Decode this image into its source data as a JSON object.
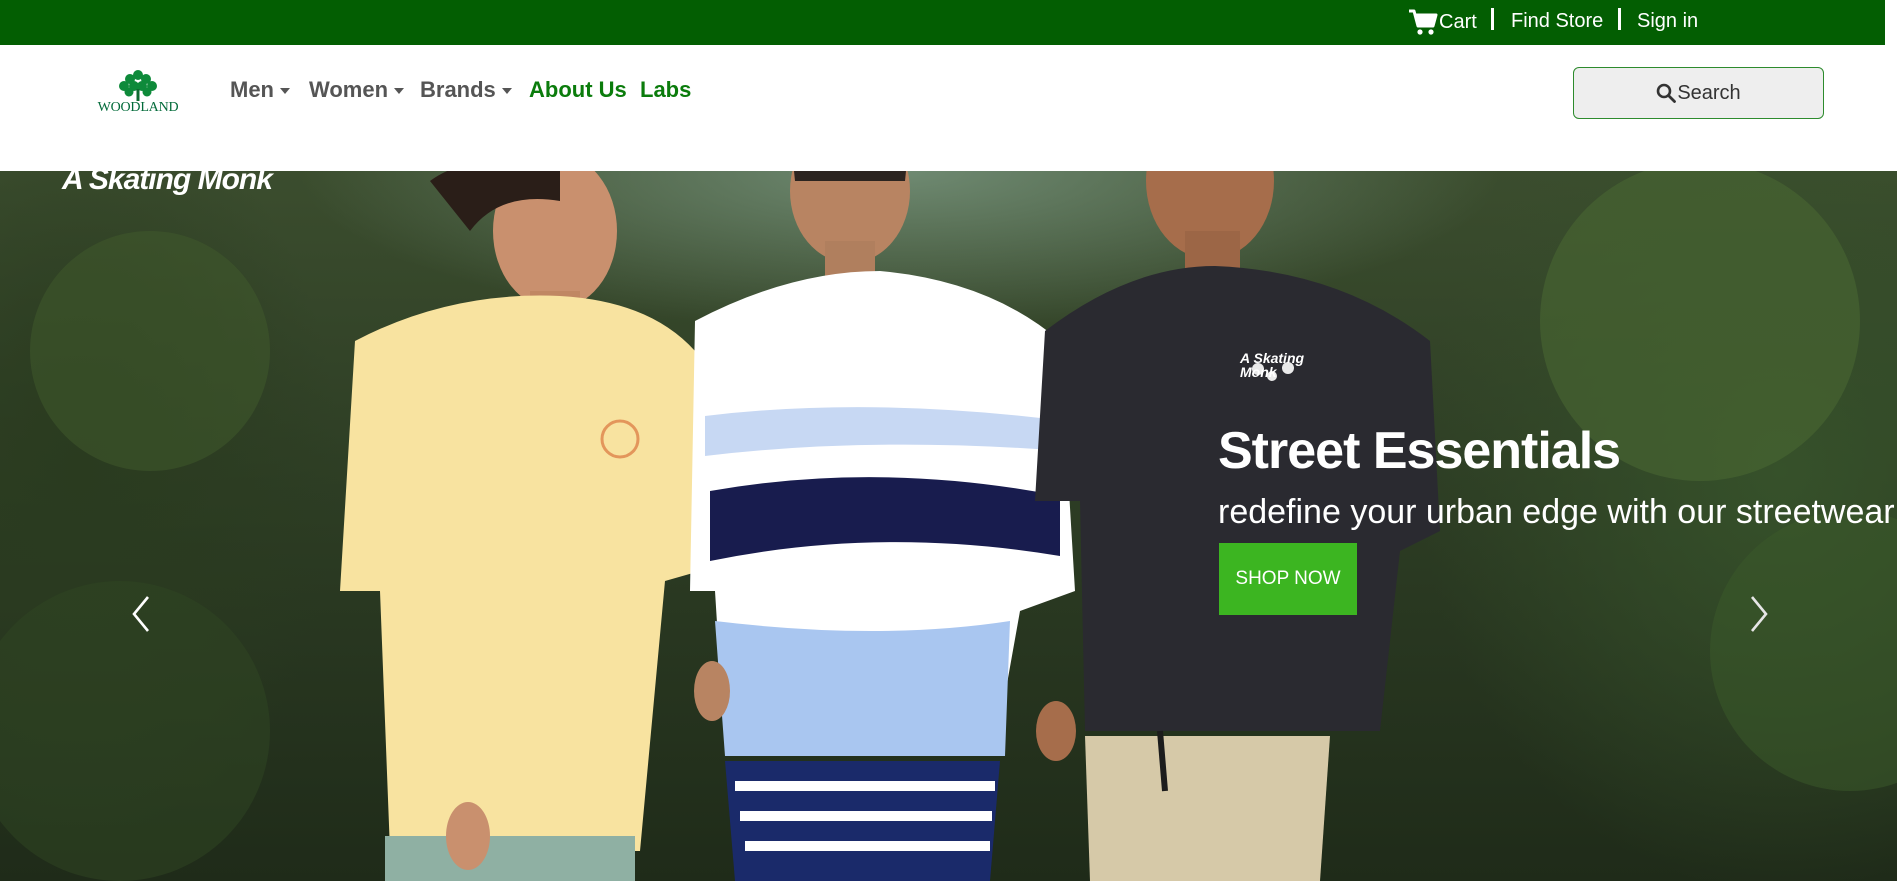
{
  "topbar": {
    "cart_label": "Cart",
    "find_store_label": "Find Store",
    "sign_in_label": "Sign in",
    "background": "#035e02"
  },
  "navbar": {
    "logo_text": "WOODLAND",
    "items": [
      {
        "label": "Men",
        "dropdown": true
      },
      {
        "label": "Women",
        "dropdown": true
      },
      {
        "label": "Brands",
        "dropdown": true
      },
      {
        "label": "About Us",
        "dropdown": false
      },
      {
        "label": "Labs",
        "dropdown": false
      }
    ],
    "search_label": "Search"
  },
  "hero": {
    "brand_overlay": "A Skating Monk",
    "shirt_print": "A Skating Monk",
    "title": "Street Essentials",
    "subtitle": "redefine your urban edge with our streetwear",
    "cta_label": "SHOP NOW",
    "cta_color": "#3cb521"
  },
  "icons": {
    "cart": "cart-icon",
    "search": "search-icon",
    "prev": "chevron-left-icon",
    "next": "chevron-right-icon"
  }
}
